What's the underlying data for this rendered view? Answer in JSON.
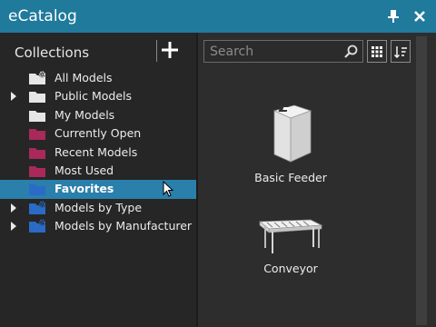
{
  "window": {
    "title": "eCatalog"
  },
  "collections": {
    "header": "Collections",
    "items": [
      {
        "label": "All Models",
        "icon": "folder-settings-icon",
        "color": "#e6e6e6",
        "expandable": false,
        "selected": false
      },
      {
        "label": "Public Models",
        "icon": "folder-icon",
        "color": "#e6e6e6",
        "expandable": true,
        "selected": false
      },
      {
        "label": "My Models",
        "icon": "folder-icon",
        "color": "#e6e6e6",
        "expandable": false,
        "selected": false
      },
      {
        "label": "Currently Open",
        "icon": "folder-icon",
        "color": "#a8295a",
        "expandable": false,
        "selected": false
      },
      {
        "label": "Recent Models",
        "icon": "folder-icon",
        "color": "#a8295a",
        "expandable": false,
        "selected": false
      },
      {
        "label": "Most Used",
        "icon": "folder-icon",
        "color": "#a8295a",
        "expandable": false,
        "selected": false
      },
      {
        "label": "Favorites",
        "icon": "folder-icon",
        "color": "#2a6bc7",
        "expandable": false,
        "selected": true
      },
      {
        "label": "Models by Type",
        "icon": "folder-settings-icon",
        "color": "#2a6bc7",
        "expandable": true,
        "selected": false
      },
      {
        "label": "Models by Manufacturer",
        "icon": "folder-settings-icon",
        "color": "#2a6bc7",
        "expandable": true,
        "selected": false
      }
    ]
  },
  "search": {
    "placeholder": "Search",
    "value": ""
  },
  "models": [
    {
      "label": "Basic Feeder",
      "icon": "feeder-icon"
    },
    {
      "label": "Conveyor",
      "icon": "conveyor-icon"
    }
  ],
  "colors": {
    "titlebar": "#1f7a9c",
    "selection": "#2a7fab",
    "accent_red": "#a8295a",
    "accent_blue": "#2a6bc7"
  }
}
